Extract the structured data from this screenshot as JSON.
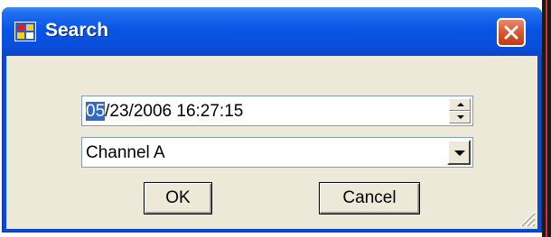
{
  "window": {
    "title": "Search",
    "icon": "app-window-icon",
    "close_icon": "close-icon"
  },
  "date_field": {
    "selected_part": "05",
    "rest": "/23/2006 16:27:15",
    "spin_up_icon": "spin-up-icon",
    "spin_down_icon": "spin-down-icon"
  },
  "channel": {
    "value": "Channel A",
    "dropdown_icon": "chevron-down-icon"
  },
  "buttons": {
    "ok_label": "OK",
    "cancel_label": "Cancel"
  },
  "colors": {
    "title_bar": "#0a55e4",
    "close_button": "#d8522e",
    "client_background": "#ece9d8",
    "selection": "#316ac5"
  }
}
